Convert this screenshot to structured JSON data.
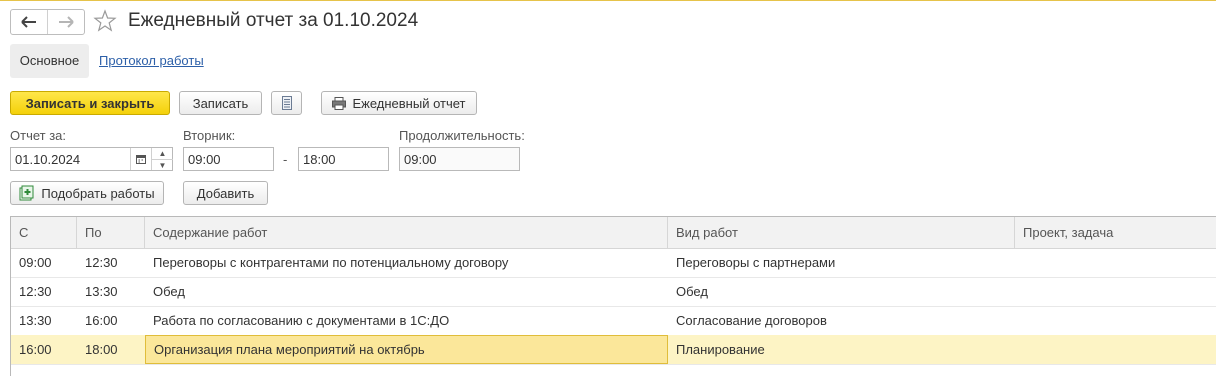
{
  "window": {
    "title": "Ежедневный отчет за 01.10.2024"
  },
  "nav": {
    "back_icon": "arrow-left-icon",
    "forward_icon": "arrow-right-icon",
    "favorite_icon": "star-icon"
  },
  "tabs": {
    "main_label": "Основное",
    "log_label": "Протокол работы"
  },
  "toolbar": {
    "save_close_label": "Записать и закрыть",
    "save_label": "Записать",
    "report_button_label": "Ежедневный отчет"
  },
  "form": {
    "report_date_label": "Отчет за:",
    "report_date_value": "01.10.2024",
    "day_label": "Вторник:",
    "time_from_value": "09:00",
    "time_to_value": "18:00",
    "time_separator": "-",
    "duration_label": "Продолжительность:",
    "duration_value": "09:00"
  },
  "actions": {
    "pick_work_label": "Подобрать работы",
    "add_label": "Добавить"
  },
  "table": {
    "columns": [
      "С",
      "По",
      "Содержание работ",
      "Вид работ",
      "Проект, задача"
    ],
    "rows": [
      {
        "from": "09:00",
        "to": "12:30",
        "content": "Переговоры с контрагентами по потенциальному договору",
        "type": "Переговоры с партнерами",
        "project": ""
      },
      {
        "from": "12:30",
        "to": "13:30",
        "content": "Обед",
        "type": "Обед",
        "project": ""
      },
      {
        "from": "13:30",
        "to": "16:00",
        "content": "Работа по согласованию с документами в 1С:ДО",
        "type": "Согласование договоров",
        "project": ""
      },
      {
        "from": "16:00",
        "to": "18:00",
        "content": "Организация плана мероприятий на октябрь",
        "type": "Планирование",
        "project": ""
      }
    ],
    "selected_row": 3
  },
  "colors": {
    "accent_yellow": "#f4d10a",
    "link_blue": "#2c5fa8",
    "selected_row": "#fdf4c5"
  }
}
